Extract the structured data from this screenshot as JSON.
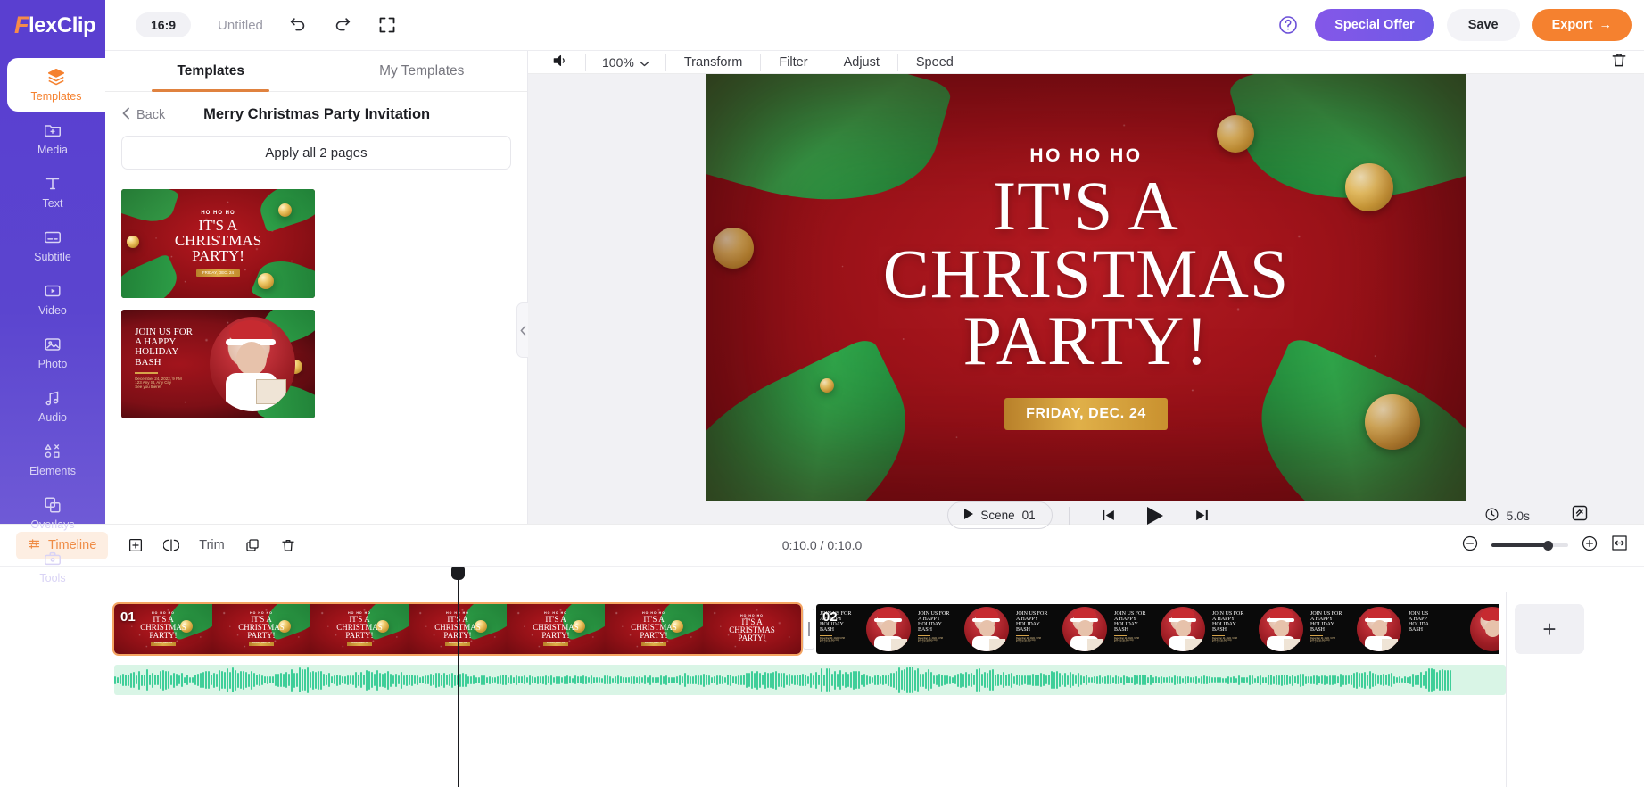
{
  "header": {
    "logo": "FlexClip",
    "logo_initial": "F",
    "aspect_ratio": "16:9",
    "project_title": "Untitled",
    "undo_icon": "undo-icon",
    "redo_icon": "redo-icon",
    "fullscreen_icon": "expand-icon",
    "help_icon": "help-circle-icon",
    "special_offer_label": "Special Offer",
    "save_label": "Save",
    "export_label": "Export",
    "export_arrow": "→",
    "colors": {
      "brand_purple": "#5a3fd0",
      "accent_orange": "#f5812f",
      "offer_purple": "#7a56e7"
    }
  },
  "sidebar": {
    "items": [
      {
        "label": "Templates",
        "icon": "layers-icon",
        "active": true
      },
      {
        "label": "Media",
        "icon": "folder-plus-icon",
        "active": false
      },
      {
        "label": "Text",
        "icon": "text-t-icon",
        "active": false
      },
      {
        "label": "Subtitle",
        "icon": "subtitle-box-icon",
        "active": false
      },
      {
        "label": "Video",
        "icon": "video-play-icon",
        "active": false
      },
      {
        "label": "Photo",
        "icon": "image-icon",
        "active": false
      },
      {
        "label": "Audio",
        "icon": "music-note-icon",
        "active": false
      },
      {
        "label": "Elements",
        "icon": "shapes-icon",
        "active": false
      },
      {
        "label": "Overlays",
        "icon": "overlay-squares-icon",
        "active": false
      },
      {
        "label": "Tools",
        "icon": "toolbox-icon",
        "active": false
      }
    ]
  },
  "panel": {
    "tabs": [
      {
        "label": "Templates",
        "active": true
      },
      {
        "label": "My Templates",
        "active": false
      }
    ],
    "back_label": "Back",
    "back_icon": "chevron-left-icon",
    "title": "Merry Christmas Party Invitation",
    "apply_all_label": "Apply all 2 pages",
    "collapse_icon": "chevron-left-icon",
    "thumbnails": [
      {
        "id": "page-1",
        "kind": "red-title",
        "eyebrow": "HO HO HO",
        "line1": "IT'S A",
        "line2": "CHRISTMAS",
        "line3": "PARTY!",
        "badge": "FRIDAY, DEC. 24"
      },
      {
        "id": "page-2",
        "kind": "dark-photo",
        "line1": "JOIN US FOR",
        "line2": "A HAPPY",
        "line3": "HOLIDAY",
        "line4": "BASH",
        "detail1": "December 24, 2022, 9 PM",
        "detail2": "123 Any St, Any City",
        "detail3": "See you there!"
      }
    ]
  },
  "control_bar": {
    "volume_icon": "speaker-icon",
    "zoom_value": "100%",
    "zoom_caret": "chevron-down-icon",
    "items": [
      "Transform",
      "Filter",
      "Adjust",
      "Speed"
    ],
    "delete_icon": "trash-icon"
  },
  "canvas": {
    "eyebrow": "HO HO HO",
    "title_line1": "IT'S A",
    "title_line2": "CHRISTMAS",
    "title_line3": "PARTY!",
    "date_badge": "FRIDAY, DEC. 24",
    "background_color": "#9c1219",
    "badge_gold": "#d0a03a"
  },
  "playback": {
    "scene_label": "Scene",
    "scene_number": "01",
    "scene_play_icon": "play-icon",
    "prev_icon": "skip-back-icon",
    "play_icon": "play-icon",
    "next_icon": "skip-forward-icon",
    "clock_icon": "clock-icon",
    "duration": "5.0s",
    "fullscreen_icon": "expand-canvas-icon"
  },
  "timeline": {
    "mode_label": "Timeline",
    "mode_icon": "timeline-icon",
    "add_icon": "plus-square-icon",
    "split_icon": "split-icon",
    "trim_label": "Trim",
    "duplicate_icon": "copy-icon",
    "delete_icon": "trash-icon",
    "time_display": "0:10.0 / 0:10.0",
    "zoom_out_icon": "minus-circle-icon",
    "zoom_in_icon": "plus-circle-icon",
    "fit_icon": "fit-width-icon",
    "add_scene_icon": "plus-icon",
    "clips": [
      {
        "number": "01",
        "selected": true,
        "kind": "red-title",
        "eyebrow": "HO HO HO",
        "line1": "IT'S A",
        "line2": "CHRISTMAS",
        "line3": "PARTY!",
        "badge": "FRIDAY, DEC. 24",
        "frames": 6
      },
      {
        "number": "02",
        "selected": false,
        "kind": "dark-photo",
        "line1": "JOIN US FOR",
        "line2": "A HAPPY",
        "line3": "HOLIDAY",
        "line4": "BASH",
        "frames": 7
      }
    ],
    "audio_track": {
      "label": "",
      "color": "#3fce99",
      "background": "#d9f5e6"
    }
  }
}
